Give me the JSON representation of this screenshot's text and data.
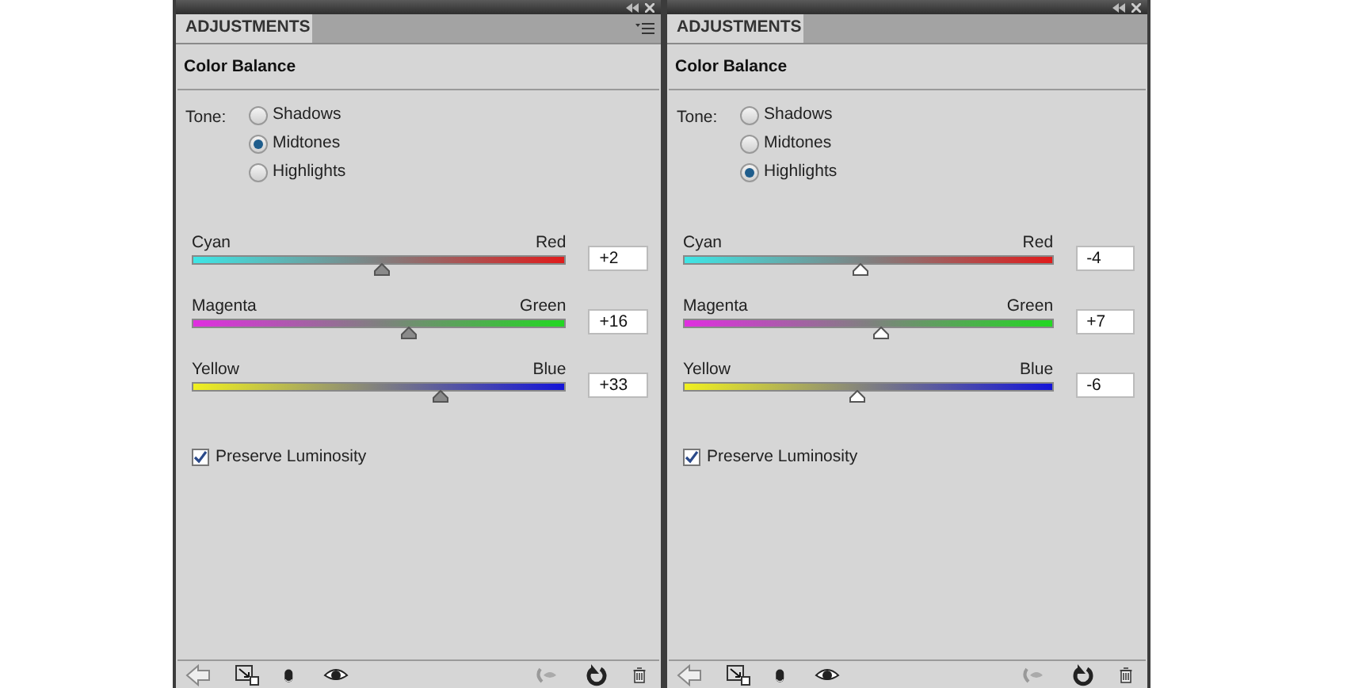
{
  "panels": [
    {
      "tab": "ADJUSTMENTS",
      "active": true,
      "title": "Color Balance",
      "tone_label": "Tone:",
      "tones": [
        {
          "label": "Shadows",
          "selected": false
        },
        {
          "label": "Midtones",
          "selected": true
        },
        {
          "label": "Highlights",
          "selected": false
        }
      ],
      "sliders": [
        {
          "kind": "cyan-red",
          "left": "Cyan",
          "right": "Red",
          "level": 0.51,
          "value": "+2"
        },
        {
          "kind": "magenta-green",
          "left": "Magenta",
          "right": "Green",
          "level": 0.58,
          "value": "+16"
        },
        {
          "kind": "yellow-blue",
          "left": "Yellow",
          "right": "Blue",
          "level": 0.665,
          "value": "+33"
        }
      ],
      "preserve": {
        "label": "Preserve Luminosity",
        "checked": true
      }
    },
    {
      "tab": "ADJUSTMENTS",
      "active": false,
      "title": "Color Balance",
      "tone_label": "Tone:",
      "tones": [
        {
          "label": "Shadows",
          "selected": false
        },
        {
          "label": "Midtones",
          "selected": false
        },
        {
          "label": "Highlights",
          "selected": true
        }
      ],
      "sliders": [
        {
          "kind": "cyan-red",
          "left": "Cyan",
          "right": "Red",
          "level": 0.48,
          "value": "-4"
        },
        {
          "kind": "magenta-green",
          "left": "Magenta",
          "right": "Green",
          "level": 0.535,
          "value": "+7"
        },
        {
          "kind": "yellow-blue",
          "left": "Yellow",
          "right": "Blue",
          "level": 0.47,
          "value": "-6"
        }
      ],
      "preserve": {
        "label": "Preserve Luminosity",
        "checked": true
      }
    }
  ]
}
